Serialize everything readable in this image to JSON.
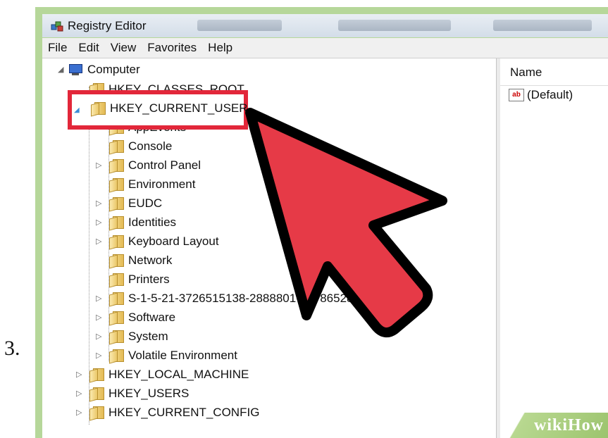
{
  "step": {
    "number": "3."
  },
  "window": {
    "title": "Registry Editor"
  },
  "menu": [
    "File",
    "Edit",
    "View",
    "Favorites",
    "Help"
  ],
  "tree": {
    "root": "Computer",
    "hives_top": [
      "HKEY_CLASSES_ROOT",
      "HKEY_CURRENT_USER"
    ],
    "current_user_children": [
      "AppEvents",
      "Console",
      "Control Panel",
      "Environment",
      "EUDC",
      "Identities",
      "Keyboard Layout",
      "Network",
      "Printers",
      "S-1-5-21-3726515138-2888801-20786528",
      "Software",
      "System",
      "Volatile Environment"
    ],
    "hives_bottom": [
      "HKEY_LOCAL_MACHINE",
      "HKEY_USERS",
      "HKEY_CURRENT_CONFIG"
    ]
  },
  "list": {
    "column_name": "Name",
    "rows": [
      {
        "name": "(Default)",
        "type_icon": "reg-string-icon",
        "icon_text": "ab"
      }
    ]
  },
  "highlight": {
    "label": "HKEY_CURRENT_USER",
    "color": "#e2273a"
  },
  "watermark": "wikiHow"
}
